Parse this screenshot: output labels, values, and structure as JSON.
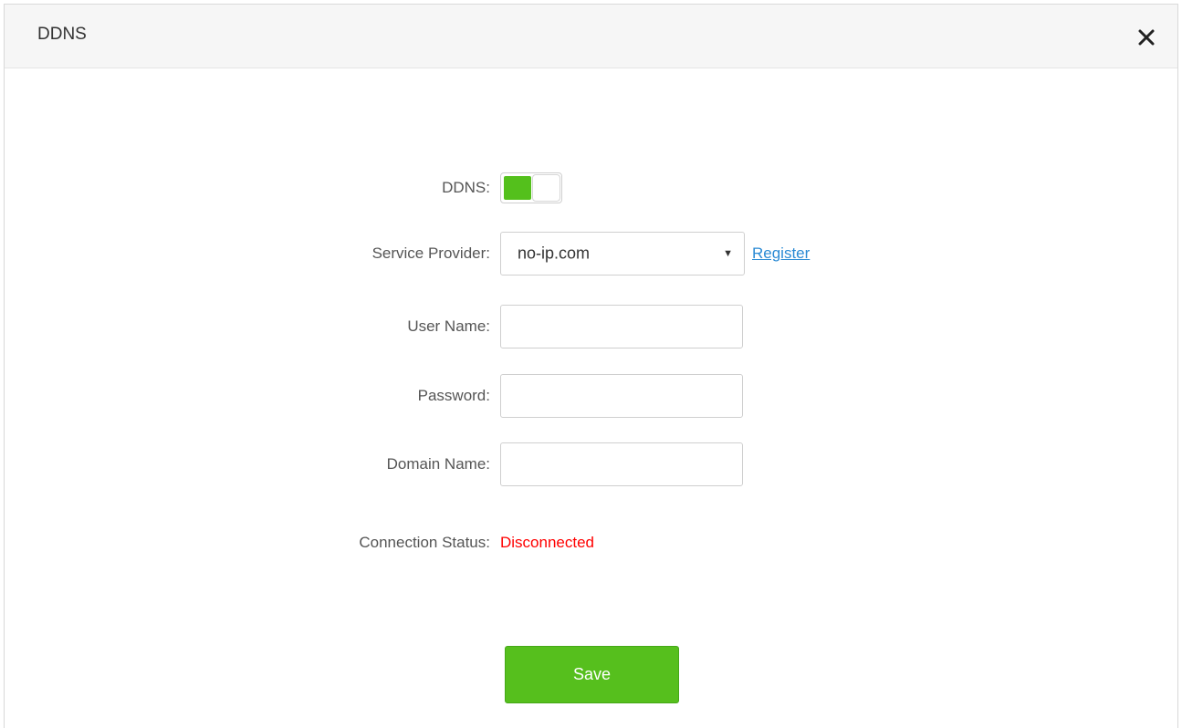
{
  "dialog": {
    "title": "DDNS",
    "close_icon": "close-icon"
  },
  "form": {
    "ddns": {
      "label": "DDNS:",
      "enabled": true
    },
    "service_provider": {
      "label": "Service Provider:",
      "value": "no-ip.com",
      "register_label": "Register"
    },
    "user_name": {
      "label": "User Name:",
      "value": "",
      "placeholder": ""
    },
    "password": {
      "label": "Password:",
      "value": "",
      "placeholder": ""
    },
    "domain_name": {
      "label": "Domain Name:",
      "value": "",
      "placeholder": ""
    },
    "connection_status": {
      "label": "Connection Status:",
      "value": "Disconnected"
    }
  },
  "actions": {
    "save_label": "Save"
  },
  "colors": {
    "accent_green": "#56bf1d",
    "link_blue": "#2a8ad4",
    "status_red": "#ff0000",
    "header_bg": "#f6f6f6"
  }
}
